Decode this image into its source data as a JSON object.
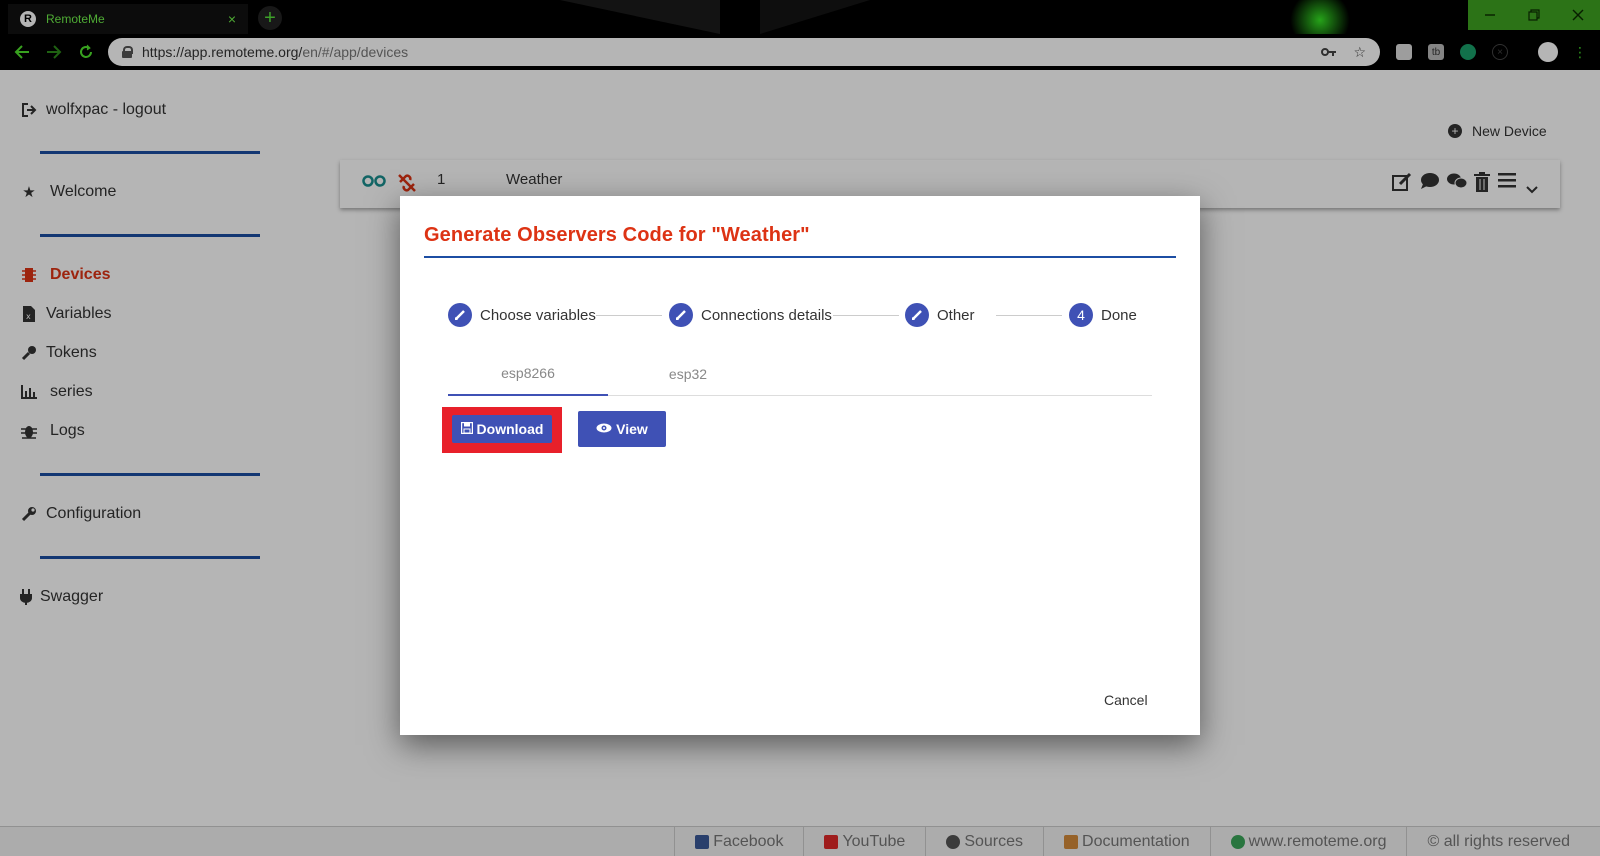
{
  "browser": {
    "tab_title": "RemoteMe",
    "tab_close": "×",
    "new_tab": "+",
    "url_host": "https://app.remoteme.org/",
    "url_path": "en/#/app/devices"
  },
  "sidebar": {
    "user": "wolfxpac - logout",
    "items": [
      {
        "label": "Welcome"
      },
      {
        "label": "Devices"
      },
      {
        "label": "Variables"
      },
      {
        "label": "Tokens"
      },
      {
        "label": "series"
      },
      {
        "label": "Logs"
      },
      {
        "label": "Configuration"
      },
      {
        "label": "Swagger"
      }
    ]
  },
  "main": {
    "new_device": "New Device",
    "device": {
      "id": "1",
      "name": "Weather"
    }
  },
  "dialog": {
    "title": "Generate Observers Code for \"Weather\"",
    "steps": [
      {
        "label": "Choose variables",
        "state": "done"
      },
      {
        "label": "Connections details",
        "state": "done"
      },
      {
        "label": "Other",
        "state": "done"
      },
      {
        "label": "Done",
        "number": "4",
        "state": "active"
      }
    ],
    "tabs": [
      {
        "label": "esp8266",
        "active": true
      },
      {
        "label": "esp32",
        "active": false
      }
    ],
    "download_label": "Download",
    "view_label": "View",
    "cancel_label": "Cancel"
  },
  "footer": {
    "links": [
      {
        "label": "Facebook",
        "color": "#3b5998"
      },
      {
        "label": "YouTube",
        "color": "#e02a2a"
      },
      {
        "label": "Sources",
        "color": "#555555"
      },
      {
        "label": "Documentation",
        "color": "#d48b3a"
      },
      {
        "label": "www.remoteme.org",
        "color": "#3aa55a"
      }
    ],
    "copyright": "© all rights reserved"
  },
  "colors": {
    "accent_red": "#dd3314",
    "primary_blue": "#3f51b5",
    "separator_blue": "#1c4ea3",
    "highlight_red": "#e8202a"
  }
}
